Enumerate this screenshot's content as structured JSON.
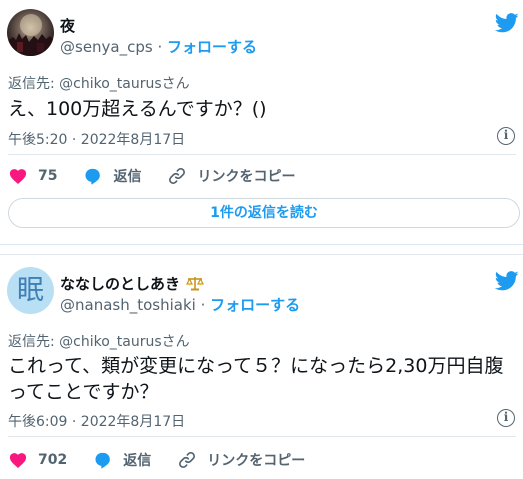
{
  "tweets": [
    {
      "display_name": "夜",
      "handle": "@senya_cps",
      "separator": "·",
      "follow_label": "フォローする",
      "reply_to": "返信先: @chiko_taurusさん",
      "text": "え、100万超えるんですか？()",
      "timestamp": "午後5:20 · 2022年8月17日",
      "likes": "75",
      "reply_label": "返信",
      "copy_link_label": "リンクをコピー",
      "view_replies_label": "1件の返信を読む"
    },
    {
      "display_name": "ななしのとしあき",
      "avatar_char": "眠",
      "handle": "@nanash_toshiaki",
      "separator": "·",
      "follow_label": "フォローする",
      "reply_to": "返信先: @chiko_taurusさん",
      "text": "これって、類が変更になって５？になったら2,30万円自腹ってことですか？",
      "timestamp": "午後6:09 · 2022年8月17日",
      "likes": "702",
      "reply_label": "返信",
      "copy_link_label": "リンクをコピー"
    }
  ],
  "colors": {
    "accent": "#1d9bf0",
    "like": "#f91880",
    "muted": "#536471",
    "text": "#0f1419"
  },
  "icons": [
    "twitter-bird-icon",
    "info-icon",
    "heart-icon",
    "reply-bubble-icon",
    "link-icon",
    "scales-emoji-icon"
  ]
}
